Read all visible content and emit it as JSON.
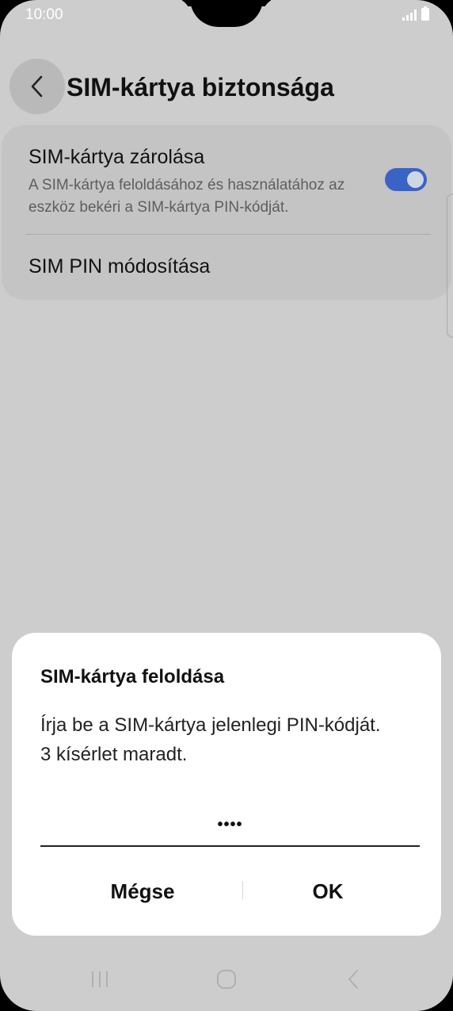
{
  "status_bar": {
    "time": "10:00"
  },
  "header": {
    "title": "SIM-kártya biztonsága"
  },
  "settings": {
    "items": [
      {
        "title": "SIM-kártya zárolása",
        "description": "A SIM-kártya feloldásához és használatához az eszköz bekéri a SIM-kártya PIN-kódját.",
        "toggle_on": true
      },
      {
        "title": "SIM PIN módosítása"
      }
    ]
  },
  "dialog": {
    "title": "SIM-kártya feloldása",
    "message_line1": "Írja be a SIM-kártya jelenlegi PIN-kódját.",
    "message_line2": "3 kísérlet maradt.",
    "pin_value": "••••",
    "cancel_label": "Mégse",
    "ok_label": "OK"
  },
  "colors": {
    "accent": "#3a63c8",
    "background": "#cdcdcd",
    "dialog": "#ffffff"
  },
  "icons": {
    "back": "chevron-left-icon",
    "nav_recents": "recents-icon",
    "nav_home": "home-icon",
    "nav_back": "nav-back-icon"
  }
}
